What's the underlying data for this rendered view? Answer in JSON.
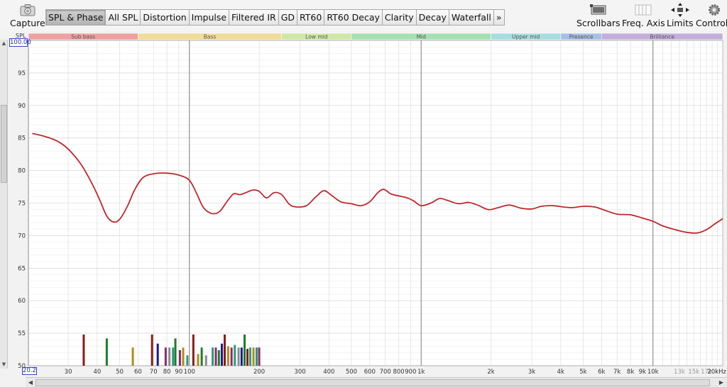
{
  "toolbar": {
    "capture_label": "Capture",
    "tabs": [
      {
        "label": "SPL & Phase",
        "active": true
      },
      {
        "label": "All SPL"
      },
      {
        "label": "Distortion"
      },
      {
        "label": "Impulse"
      },
      {
        "label": "Filtered IR"
      },
      {
        "label": "GD"
      },
      {
        "label": "RT60"
      },
      {
        "label": "RT60 Decay"
      },
      {
        "label": "Clarity"
      },
      {
        "label": "Decay"
      },
      {
        "label": "Waterfall"
      },
      {
        "label": "»"
      }
    ],
    "right_tools": [
      {
        "label": "Scrollbars",
        "icon": "scrollbars-icon"
      },
      {
        "label": "Freq. Axis",
        "icon": "freq-axis-icon"
      },
      {
        "label": "Limits",
        "icon": "limits-icon"
      },
      {
        "label": "Controls",
        "icon": "gear-icon"
      }
    ]
  },
  "axis": {
    "spl_label": "SPL",
    "ymax_value": "100.00",
    "xmin_value": "20.2"
  },
  "bands": [
    {
      "label": "Sub bass",
      "from": 20.2,
      "to": 60,
      "color": "#f0a0a0"
    },
    {
      "label": "Bass",
      "from": 60,
      "to": 250,
      "color": "#f2dc96"
    },
    {
      "label": "Low mid",
      "from": 250,
      "to": 500,
      "color": "#cfe8a6"
    },
    {
      "label": "Mid",
      "from": 500,
      "to": 2000,
      "color": "#a6e0b0"
    },
    {
      "label": "Upper mid",
      "from": 2000,
      "to": 4000,
      "color": "#a6dde0"
    },
    {
      "label": "Presence",
      "from": 4000,
      "to": 6000,
      "color": "#a6bfe6"
    },
    {
      "label": "Brilliance",
      "from": 6000,
      "to": 20000,
      "color": "#c3aedb"
    }
  ],
  "chart_data": {
    "type": "line",
    "title": "",
    "xlabel": "",
    "ylabel": "SPL",
    "x_scale": "log",
    "xlim": [
      20.2,
      20000
    ],
    "ylim": [
      50,
      100
    ],
    "grid": true,
    "y_ticks": [
      50,
      55,
      60,
      65,
      70,
      75,
      80,
      85,
      90,
      95
    ],
    "x_ticks": [
      {
        "v": 30,
        "label": "30"
      },
      {
        "v": 40,
        "label": "40"
      },
      {
        "v": 50,
        "label": "50"
      },
      {
        "v": 60,
        "label": "60"
      },
      {
        "v": 70,
        "label": "70"
      },
      {
        "v": 80,
        "label": "80"
      },
      {
        "v": 90,
        "label": "90"
      },
      {
        "v": 100,
        "label": "100"
      },
      {
        "v": 200,
        "label": "200"
      },
      {
        "v": 300,
        "label": "300"
      },
      {
        "v": 400,
        "label": "400"
      },
      {
        "v": 500,
        "label": "500"
      },
      {
        "v": 600,
        "label": "600"
      },
      {
        "v": 700,
        "label": "700"
      },
      {
        "v": 800,
        "label": "800"
      },
      {
        "v": 900,
        "label": "900"
      },
      {
        "v": 1000,
        "label": "1k"
      },
      {
        "v": 2000,
        "label": "2k"
      },
      {
        "v": 3000,
        "label": "3k"
      },
      {
        "v": 4000,
        "label": "4k"
      },
      {
        "v": 5000,
        "label": "5k"
      },
      {
        "v": 6000,
        "label": "6k"
      },
      {
        "v": 7000,
        "label": "7k"
      },
      {
        "v": 8000,
        "label": "8k"
      },
      {
        "v": 9000,
        "label": "9k"
      },
      {
        "v": 10000,
        "label": "10k"
      },
      {
        "v": 13000,
        "label": "13k"
      },
      {
        "v": 15000,
        "label": "15k"
      },
      {
        "v": 17000,
        "label": "17k"
      },
      {
        "v": 20000,
        "label": "20kHz"
      }
    ],
    "series": [
      {
        "color": "#c0282b",
        "points": [
          [
            21,
            85.7
          ],
          [
            24,
            85.2
          ],
          [
            27,
            84.5
          ],
          [
            30,
            83.3
          ],
          [
            34,
            81
          ],
          [
            38,
            78
          ],
          [
            41,
            75.5
          ],
          [
            44,
            73
          ],
          [
            47,
            72.1
          ],
          [
            50,
            72.5
          ],
          [
            54,
            74.5
          ],
          [
            58,
            77
          ],
          [
            63,
            78.9
          ],
          [
            70,
            79.5
          ],
          [
            80,
            79.6
          ],
          [
            90,
            79.3
          ],
          [
            100,
            78.5
          ],
          [
            108,
            76.3
          ],
          [
            115,
            74.3
          ],
          [
            125,
            73.4
          ],
          [
            135,
            73.7
          ],
          [
            145,
            75.2
          ],
          [
            155,
            76.4
          ],
          [
            165,
            76.3
          ],
          [
            175,
            76.6
          ],
          [
            188,
            77
          ],
          [
            200,
            76.8
          ],
          [
            215,
            75.8
          ],
          [
            232,
            76.6
          ],
          [
            250,
            76.3
          ],
          [
            270,
            74.8
          ],
          [
            290,
            74.4
          ],
          [
            320,
            74.6
          ],
          [
            350,
            75.9
          ],
          [
            380,
            76.9
          ],
          [
            410,
            76.2
          ],
          [
            450,
            75.2
          ],
          [
            500,
            74.9
          ],
          [
            550,
            74.6
          ],
          [
            600,
            75.2
          ],
          [
            650,
            76.6
          ],
          [
            690,
            77.1
          ],
          [
            740,
            76.4
          ],
          [
            800,
            76.1
          ],
          [
            870,
            75.8
          ],
          [
            930,
            75.3
          ],
          [
            1000,
            74.6
          ],
          [
            1100,
            75
          ],
          [
            1200,
            75.7
          ],
          [
            1300,
            75.4
          ],
          [
            1450,
            74.9
          ],
          [
            1600,
            75.1
          ],
          [
            1750,
            74.7
          ],
          [
            1950,
            74
          ],
          [
            2150,
            74.3
          ],
          [
            2400,
            74.7
          ],
          [
            2700,
            74.2
          ],
          [
            3000,
            74.1
          ],
          [
            3300,
            74.5
          ],
          [
            3700,
            74.6
          ],
          [
            4100,
            74.4
          ],
          [
            4500,
            74.3
          ],
          [
            5000,
            74.5
          ],
          [
            5600,
            74.4
          ],
          [
            6200,
            73.9
          ],
          [
            7000,
            73.3
          ],
          [
            8000,
            73.2
          ],
          [
            9000,
            72.7
          ],
          [
            10000,
            72.2
          ],
          [
            11000,
            71.5
          ],
          [
            12500,
            70.9
          ],
          [
            14000,
            70.5
          ],
          [
            15500,
            70.4
          ],
          [
            17000,
            70.9
          ],
          [
            18500,
            71.8
          ],
          [
            20000,
            72.6
          ]
        ]
      }
    ],
    "peak_markers": [
      {
        "f": 35,
        "spl": 54.8,
        "color": "#8b1a1a"
      },
      {
        "f": 44,
        "spl": 54.2,
        "color": "#1e7d2b"
      },
      {
        "f": 57,
        "spl": 52.8,
        "color": "#b08c1e"
      },
      {
        "f": 69,
        "spl": 54.8,
        "color": "#8b1a1a"
      },
      {
        "f": 73,
        "spl": 53.4,
        "color": "#1a1a8b"
      },
      {
        "f": 79,
        "spl": 52.8,
        "color": "#8b2a6b"
      },
      {
        "f": 82,
        "spl": 52.8,
        "color": "#8c8c8c"
      },
      {
        "f": 85,
        "spl": 52.8,
        "color": "#2b9b7b"
      },
      {
        "f": 87,
        "spl": 54.2,
        "color": "#1e7d2b"
      },
      {
        "f": 91,
        "spl": 52.4,
        "color": "#8b2a6b"
      },
      {
        "f": 94,
        "spl": 52.8,
        "color": "#b08c1e"
      },
      {
        "f": 98,
        "spl": 51.6,
        "color": "#2b9b7b"
      },
      {
        "f": 104,
        "spl": 54.8,
        "color": "#8b1a1a"
      },
      {
        "f": 109,
        "spl": 51.8,
        "color": "#b08c1e"
      },
      {
        "f": 113,
        "spl": 52.8,
        "color": "#1e7d2b"
      },
      {
        "f": 118,
        "spl": 51.6,
        "color": "#8c8c8c"
      },
      {
        "f": 126,
        "spl": 52.8,
        "color": "#2b9b7b"
      },
      {
        "f": 130,
        "spl": 52.8,
        "color": "#8b2a6b"
      },
      {
        "f": 134,
        "spl": 52.4,
        "color": "#1e7d2b"
      },
      {
        "f": 138,
        "spl": 53.4,
        "color": "#1a1a8b"
      },
      {
        "f": 142,
        "spl": 54.8,
        "color": "#8b1a1a"
      },
      {
        "f": 147,
        "spl": 53,
        "color": "#b08c1e"
      },
      {
        "f": 152,
        "spl": 52.8,
        "color": "#8b2a6b"
      },
      {
        "f": 157,
        "spl": 53.2,
        "color": "#2b9b7b"
      },
      {
        "f": 163,
        "spl": 52.8,
        "color": "#8c8c8c"
      },
      {
        "f": 168,
        "spl": 52.8,
        "color": "#1a1a8b"
      },
      {
        "f": 173,
        "spl": 54.8,
        "color": "#1e7d2b"
      },
      {
        "f": 178,
        "spl": 52.6,
        "color": "#8b1a1a"
      },
      {
        "f": 183,
        "spl": 52.8,
        "color": "#2b9b7b"
      },
      {
        "f": 189,
        "spl": 52.8,
        "color": "#b08c1e"
      },
      {
        "f": 195,
        "spl": 52.8,
        "color": "#2b9b7b"
      },
      {
        "f": 200,
        "spl": 52.8,
        "color": "#8b2a6b"
      }
    ]
  }
}
